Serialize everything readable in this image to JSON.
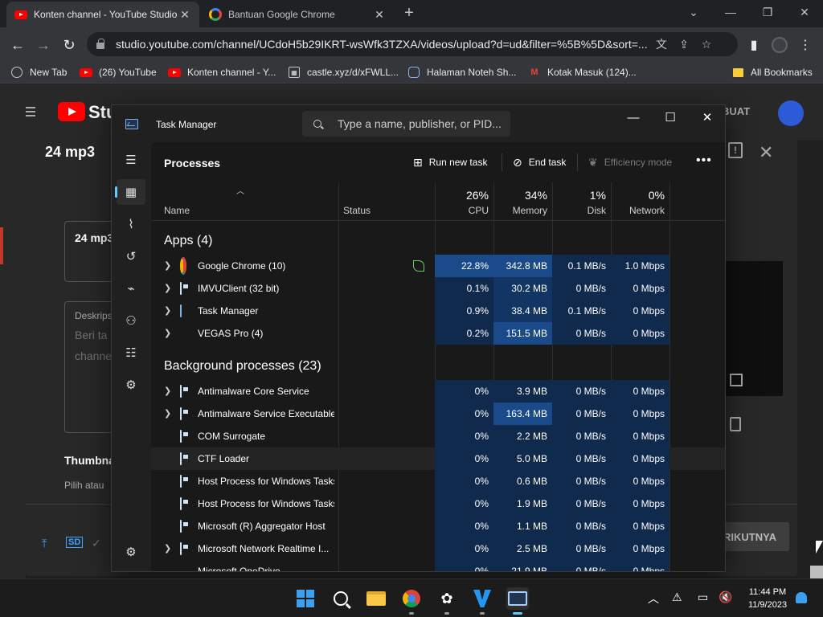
{
  "browser": {
    "tabs": [
      {
        "title": "Konten channel - YouTube Studio",
        "active": true,
        "favicon": "youtube-icon"
      },
      {
        "title": "Bantuan Google Chrome",
        "active": false,
        "favicon": "google-icon"
      }
    ],
    "url": "studio.youtube.com/channel/UCdoH5b29IKRT-wsWfk3TZXA/videos/upload?d=ud&filter=%5B%5D&sort=...",
    "bookmarks": [
      {
        "label": "New Tab",
        "icon": "globe-icon"
      },
      {
        "label": "(26) YouTube",
        "icon": "youtube-icon"
      },
      {
        "label": "Konten channel - Y...",
        "icon": "youtube-icon"
      },
      {
        "label": "castle.xyz/d/xFWLL...",
        "icon": "castle-icon"
      },
      {
        "label": "Halaman Noteh Sh...",
        "icon": "discord-icon"
      },
      {
        "label": "Kotak Masuk (124)...",
        "icon": "gmail-icon"
      }
    ],
    "all_bookmarks": "All Bookmarks"
  },
  "studio": {
    "logo_word": "Stu",
    "create_label": "BUAT",
    "dialog_title": "24 mp3",
    "title_value": "24 mp3",
    "desc_label": "Deskrips",
    "desc_placeholder_1": "Beri ta",
    "desc_placeholder_2": "channe",
    "thumbnail_label": "Thumbna",
    "thumbnail_hint": "Pilih atau",
    "next_label": "RIKUTNYA",
    "footer_sd": "SD"
  },
  "taskmanager": {
    "title": "Task Manager",
    "search_placeholder": "Type a name, publisher, or PID...",
    "heading": "Processes",
    "commands": {
      "run_new_task": "Run new task",
      "end_task": "End task",
      "efficiency_mode": "Efficiency mode"
    },
    "columns": {
      "name": "Name",
      "status": "Status",
      "cpu": {
        "pct": "26%",
        "label": "CPU"
      },
      "memory": {
        "pct": "34%",
        "label": "Memory"
      },
      "disk": {
        "pct": "1%",
        "label": "Disk"
      },
      "network": {
        "pct": "0%",
        "label": "Network"
      }
    },
    "apps_group": "Apps (4)",
    "apps": [
      {
        "name": "Google Chrome (10)",
        "cpu": "22.8%",
        "mem": "342.8 MB",
        "disk": "0.1 MB/s",
        "net": "1.0 Mbps",
        "icon": "chrome-icon",
        "expand": true,
        "eco": true
      },
      {
        "name": "IMVUClient (32 bit)",
        "cpu": "0.1%",
        "mem": "30.2 MB",
        "disk": "0 MB/s",
        "net": "0 Mbps",
        "icon": "app-window-icon",
        "expand": true
      },
      {
        "name": "Task Manager",
        "cpu": "0.9%",
        "mem": "38.4 MB",
        "disk": "0.1 MB/s",
        "net": "0 Mbps",
        "icon": "task-manager-icon",
        "expand": true
      },
      {
        "name": "VEGAS Pro (4)",
        "cpu": "0.2%",
        "mem": "151.5 MB",
        "disk": "0 MB/s",
        "net": "0 Mbps",
        "icon": "vegas-icon",
        "expand": true
      }
    ],
    "bg_group": "Background processes (23)",
    "background": [
      {
        "name": "Antimalware Core Service",
        "cpu": "0%",
        "mem": "3.9 MB",
        "disk": "0 MB/s",
        "net": "0 Mbps",
        "expand": true
      },
      {
        "name": "Antimalware Service Executable",
        "cpu": "0%",
        "mem": "163.4 MB",
        "disk": "0 MB/s",
        "net": "0 Mbps",
        "expand": true
      },
      {
        "name": "COM Surrogate",
        "cpu": "0%",
        "mem": "2.2 MB",
        "disk": "0 MB/s",
        "net": "0 Mbps",
        "expand": false
      },
      {
        "name": "CTF Loader",
        "cpu": "0%",
        "mem": "5.0 MB",
        "disk": "0 MB/s",
        "net": "0 Mbps",
        "expand": false
      },
      {
        "name": "Host Process for Windows Tasks",
        "cpu": "0%",
        "mem": "0.6 MB",
        "disk": "0 MB/s",
        "net": "0 Mbps",
        "expand": false
      },
      {
        "name": "Host Process for Windows Tasks",
        "cpu": "0%",
        "mem": "1.9 MB",
        "disk": "0 MB/s",
        "net": "0 Mbps",
        "expand": false
      },
      {
        "name": "Microsoft (R) Aggregator Host",
        "cpu": "0%",
        "mem": "1.1 MB",
        "disk": "0 MB/s",
        "net": "0 Mbps",
        "expand": false
      },
      {
        "name": "Microsoft Network Realtime I...",
        "cpu": "0%",
        "mem": "2.5 MB",
        "disk": "0 MB/s",
        "net": "0 Mbps",
        "expand": true
      },
      {
        "name": "Microsoft OneDrive",
        "cpu": "0%",
        "mem": "21.9 MB",
        "disk": "0 MB/s",
        "net": "0 Mbps",
        "expand": false
      }
    ],
    "colors": {
      "cpu_high": "#1a4a8a",
      "cell_low": "#0f2a4d",
      "cell_mid": "#123563",
      "accent": "#60cdff"
    }
  },
  "taskbar": {
    "time": "11:44 PM",
    "date": "11/9/2023"
  }
}
